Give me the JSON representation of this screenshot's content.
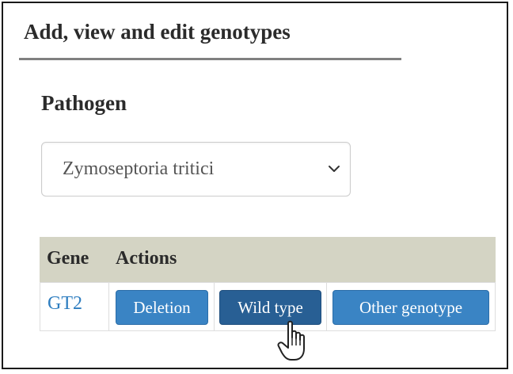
{
  "header": {
    "title": "Add, view and edit genotypes"
  },
  "pathogen": {
    "label": "Pathogen",
    "selected": "Zymoseptoria tritici"
  },
  "table": {
    "columns": [
      "Gene",
      "Actions"
    ],
    "rows": [
      {
        "gene": "GT2",
        "actions": [
          "Deletion",
          "Wild type",
          "Other genotype"
        ]
      }
    ]
  },
  "colors": {
    "header_bg": "#d4d4c4",
    "button": "#3a84c4",
    "button_active": "#285f94",
    "link": "#2f7ec0"
  },
  "icons": {
    "select": "chevron-down-icon",
    "cursor": "hand-pointer-icon"
  }
}
